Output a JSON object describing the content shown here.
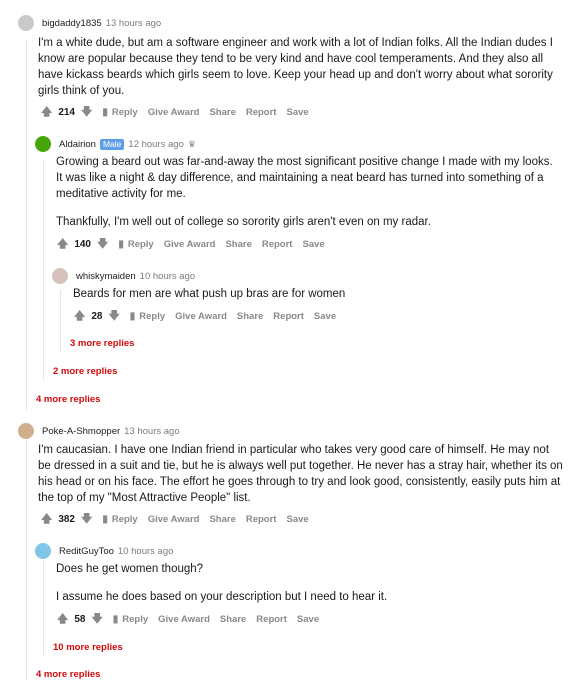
{
  "comments": [
    {
      "author": "bigdaddy1835",
      "time": "13 hours ago",
      "paragraphs": [
        "I'm a white dude, but am a software engineer and work with a lot of Indian folks. All the Indian dudes I know are popular because they tend to be very kind and have cool temperaments. And they also all have kickass beards which girls seem to love. Keep your head up and don't worry about what sorority girls think of you."
      ],
      "score": "214"
    },
    {
      "author": "Aldairion",
      "flair": "Male",
      "time": "12 hours ago",
      "paragraphs": [
        "Growing a beard out was far-and-away the most significant positive change I made with my looks. It was like a night & day difference, and maintaining a neat beard has turned into something of a meditative activity for me.",
        "Thankfully, I'm well out of college so sorority girls aren't even on my radar."
      ],
      "score": "140"
    },
    {
      "author": "whiskymaiden",
      "time": "10 hours ago",
      "paragraphs": [
        "Beards for men are what push up bras are for women"
      ],
      "score": "28"
    },
    {
      "author": "Poke-A-Shmopper",
      "time": "13 hours ago",
      "paragraphs": [
        "I'm caucasian. I have one Indian friend in particular who takes very good care of himself. He may not be dressed in a suit and tie, but he is always well put together. He never has a stray hair, whether its on his head or on his face. The effort he goes through to try and look good, consistently, easily puts him at the top of my \"Most Attractive People\" list."
      ],
      "score": "382"
    },
    {
      "author": "ReditGuyToo",
      "time": "10 hours ago",
      "paragraphs": [
        "Does he get women though?",
        "I assume he does based on your description but I need to hear it."
      ],
      "score": "58"
    }
  ],
  "actions": {
    "reply": "Reply",
    "give_award": "Give Award",
    "share": "Share",
    "report": "Report",
    "save": "Save"
  },
  "more": {
    "m1": "3 more replies",
    "m2": "2 more replies",
    "m3": "4 more replies",
    "m4": "10 more replies",
    "m5": "4 more replies"
  },
  "colors": {
    "more_link": "#d10a0a",
    "flair_bg": "#5e9fe8",
    "meta": "#878a8c"
  },
  "icons": {
    "upvote": "arrow-up-icon",
    "downvote": "arrow-down-icon",
    "reply": "speech-bubble-icon",
    "award": "award-icon"
  }
}
